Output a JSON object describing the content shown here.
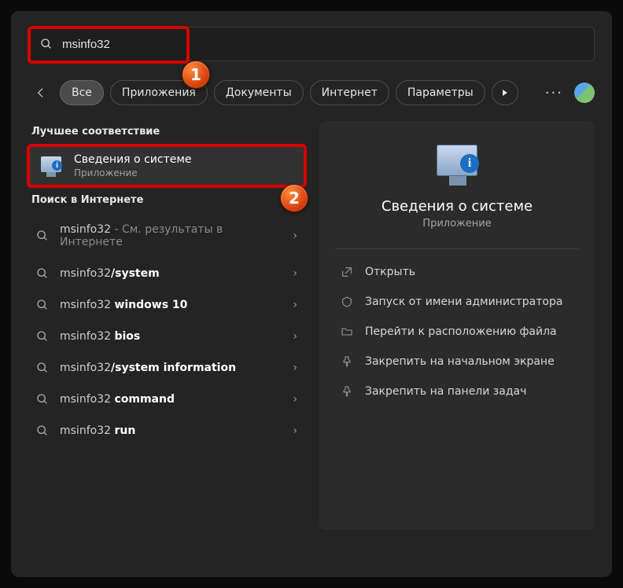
{
  "search": {
    "value": "msinfo32"
  },
  "filters": {
    "items": [
      {
        "label": "Все",
        "active": true
      },
      {
        "label": "Приложения"
      },
      {
        "label": "Документы"
      },
      {
        "label": "Интернет"
      },
      {
        "label": "Параметры"
      }
    ]
  },
  "sections": {
    "best": "Лучшее соответствие",
    "web": "Поиск в Интернете"
  },
  "best_match": {
    "title": "Сведения о системе",
    "subtitle": "Приложение"
  },
  "web_results": [
    {
      "prefix": "msinfo32",
      "bold": "",
      "suffix_dim": " - См. результаты в Интернете"
    },
    {
      "prefix": "msinfo32",
      "bold": "/system",
      "suffix_dim": ""
    },
    {
      "prefix": "msinfo32 ",
      "bold": "windows 10",
      "suffix_dim": ""
    },
    {
      "prefix": "msinfo32 ",
      "bold": "bios",
      "suffix_dim": ""
    },
    {
      "prefix": "msinfo32",
      "bold": "/system information",
      "suffix_dim": ""
    },
    {
      "prefix": "msinfo32 ",
      "bold": "command",
      "suffix_dim": ""
    },
    {
      "prefix": "msinfo32 ",
      "bold": "run",
      "suffix_dim": ""
    }
  ],
  "preview": {
    "title": "Сведения о системе",
    "subtitle": "Приложение",
    "actions": [
      {
        "icon": "open-icon",
        "label": "Открыть"
      },
      {
        "icon": "run-admin-icon",
        "label": "Запуск от имени администратора"
      },
      {
        "icon": "folder-icon",
        "label": "Перейти к расположению файла"
      },
      {
        "icon": "pin-start-icon",
        "label": "Закрепить на начальном экране"
      },
      {
        "icon": "pin-taskbar-icon",
        "label": "Закрепить на панели задач"
      }
    ]
  },
  "badges": {
    "b1": "1",
    "b2": "2"
  }
}
